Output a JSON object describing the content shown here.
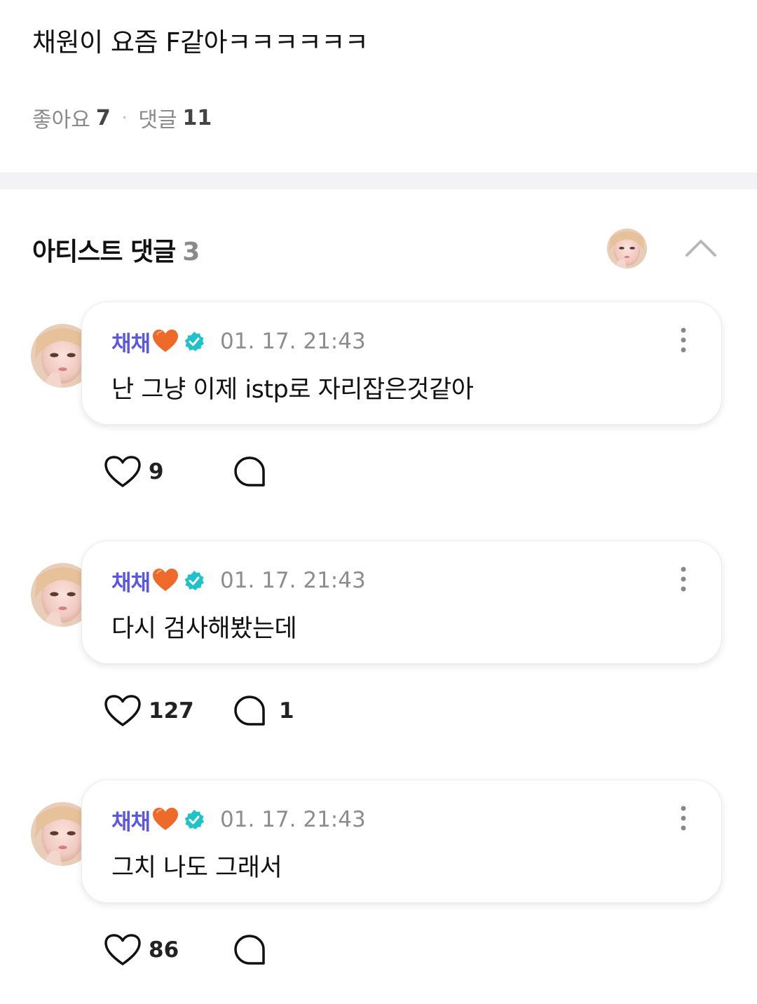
{
  "post": {
    "text": "채원이 요즘 F같아ㅋㅋㅋㅋㅋㅋ",
    "likes_label": "좋아요",
    "likes_count": "7",
    "separator": "·",
    "comments_label": "댓글",
    "comments_count": "11"
  },
  "artist_section": {
    "title": "아티스트 댓글",
    "count": "3"
  },
  "comments": [
    {
      "author": "채채",
      "time": "01. 17. 21:43",
      "text": "난 그냥 이제 istp로 자리잡은것같아",
      "likes": "9",
      "replies": ""
    },
    {
      "author": "채채",
      "time": "01. 17. 21:43",
      "text": "다시 검사해봤는데",
      "likes": "127",
      "replies": "1"
    },
    {
      "author": "채채",
      "time": "01. 17. 21:43",
      "text": "그치 나도 그래서",
      "likes": "86",
      "replies": ""
    }
  ],
  "colors": {
    "author": "#5b57e6",
    "verified": "#1fc2c9",
    "heart_emoji": "#ee6a2a",
    "muted": "#8d8d8d"
  },
  "icons": {
    "verified": "verified-badge-icon",
    "heart_emoji": "orange-heart-emoji",
    "like": "heart-outline-icon",
    "reply": "speech-bubble-icon",
    "more": "more-vertical-icon",
    "collapse": "chevron-up-icon"
  }
}
